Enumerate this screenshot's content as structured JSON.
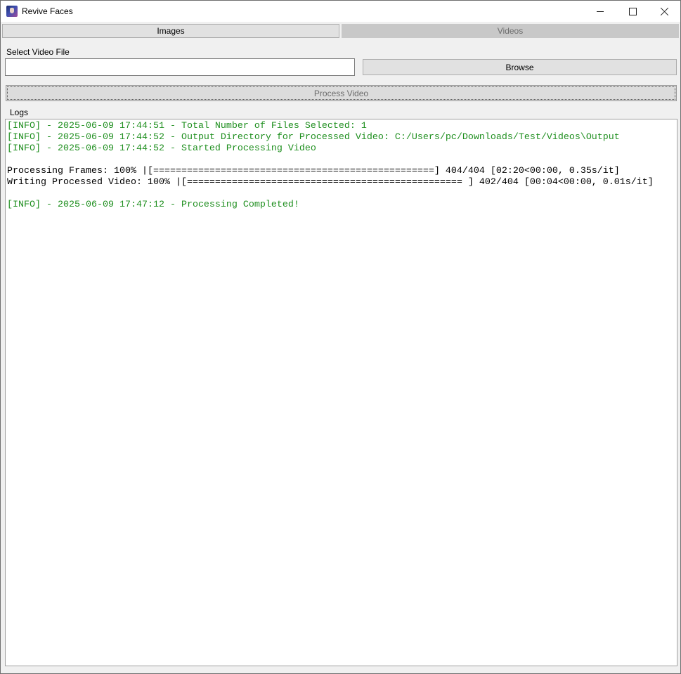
{
  "window": {
    "title": "Revive Faces"
  },
  "tabs": [
    {
      "label": "Images",
      "active": true
    },
    {
      "label": "Videos",
      "active": false
    }
  ],
  "file_select": {
    "label": "Select Video File",
    "value": "",
    "browse_label": "Browse"
  },
  "process": {
    "label": "Process Video"
  },
  "logs": {
    "label": "Logs",
    "lines": [
      {
        "text": "[INFO] - 2025-06-09 17:44:51 - Total Number of Files Selected: 1",
        "kind": "info"
      },
      {
        "text": "[INFO] - 2025-06-09 17:44:52 - Output Directory for Processed Video: C:/Users/pc/Downloads/Test/Videos\\Output",
        "kind": "info"
      },
      {
        "text": "[INFO] - 2025-06-09 17:44:52 - Started Processing Video",
        "kind": "info"
      },
      {
        "text": "",
        "kind": "plain"
      },
      {
        "text": "Processing Frames: 100% |[==================================================] 404/404 [02:20<00:00, 0.35s/it]",
        "kind": "plain"
      },
      {
        "text": "Writing Processed Video: 100% |[================================================= ] 402/404 [00:04<00:00, 0.01s/it]",
        "kind": "plain"
      },
      {
        "text": "",
        "kind": "plain"
      },
      {
        "text": "[INFO] - 2025-06-09 17:47:12 - Processing Completed!",
        "kind": "info"
      }
    ]
  },
  "colors": {
    "info_text": "#1f8f1f",
    "disabled_text": "#6d6d6d"
  },
  "icons": {
    "app": "app-logo-icon",
    "minimize": "minimize-icon",
    "maximize": "maximize-icon",
    "close": "close-icon"
  }
}
